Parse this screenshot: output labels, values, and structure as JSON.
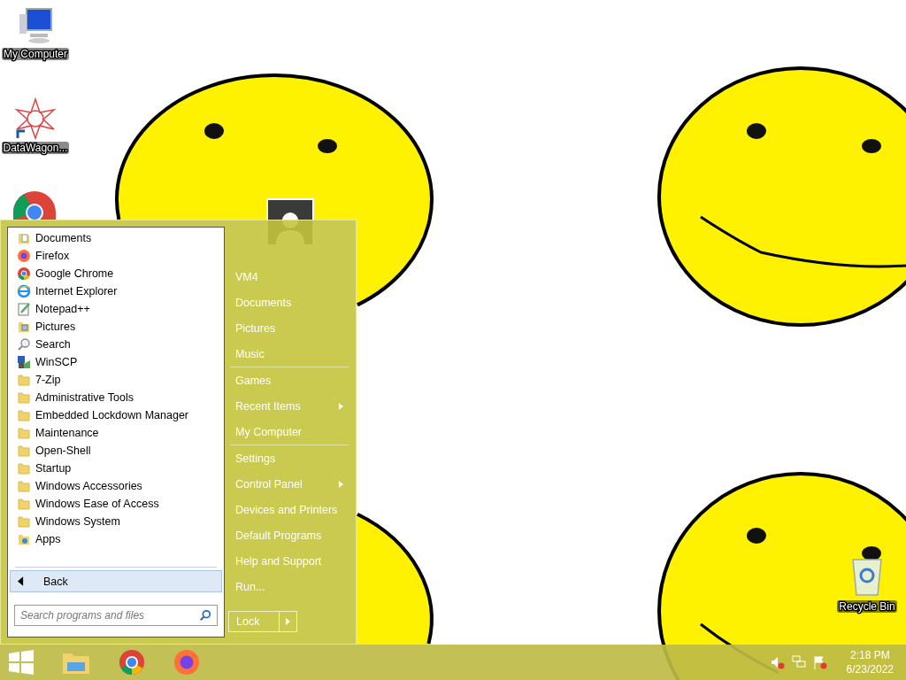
{
  "desktop_icons": [
    {
      "label": "My Computer",
      "kind": "computer"
    },
    {
      "label": "DataWagon...",
      "kind": "shortcut"
    },
    {
      "label": "Recycle Bin",
      "kind": "bin"
    }
  ],
  "start_menu": {
    "programs": [
      {
        "label": "Documents",
        "kind": "app"
      },
      {
        "label": "Firefox",
        "kind": "app"
      },
      {
        "label": "Google Chrome",
        "kind": "app"
      },
      {
        "label": "Internet Explorer",
        "kind": "app"
      },
      {
        "label": "Notepad++",
        "kind": "app"
      },
      {
        "label": "Pictures",
        "kind": "app"
      },
      {
        "label": "Search",
        "kind": "app"
      },
      {
        "label": "WinSCP",
        "kind": "app"
      },
      {
        "label": "7-Zip",
        "kind": "folder"
      },
      {
        "label": "Administrative Tools",
        "kind": "folder"
      },
      {
        "label": "Embedded Lockdown Manager",
        "kind": "folder"
      },
      {
        "label": "Maintenance",
        "kind": "folder"
      },
      {
        "label": "Open-Shell",
        "kind": "folder"
      },
      {
        "label": "Startup",
        "kind": "folder"
      },
      {
        "label": "Windows Accessories",
        "kind": "folder"
      },
      {
        "label": "Windows Ease of Access",
        "kind": "folder"
      },
      {
        "label": "Windows System",
        "kind": "folder"
      },
      {
        "label": "Apps",
        "kind": "app"
      }
    ],
    "back": {
      "label": "Back",
      "selected": true
    },
    "search": {
      "placeholder": "Search programs and files"
    },
    "places": [
      [
        {
          "label": "VM4",
          "submenu": false
        },
        {
          "label": "Documents",
          "submenu": false
        },
        {
          "label": "Pictures",
          "submenu": false
        },
        {
          "label": "Music",
          "submenu": false
        }
      ],
      [
        {
          "label": "Games",
          "submenu": false
        },
        {
          "label": "Recent Items",
          "submenu": true
        },
        {
          "label": "My Computer",
          "submenu": false
        }
      ],
      [
        {
          "label": "Settings",
          "submenu": false
        },
        {
          "label": "Control Panel",
          "submenu": true
        },
        {
          "label": "Devices and Printers",
          "submenu": false
        },
        {
          "label": "Default Programs",
          "submenu": false
        },
        {
          "label": "Help and Support",
          "submenu": false
        },
        {
          "label": "Run...",
          "submenu": false
        }
      ]
    ],
    "lock": {
      "label": "Lock"
    }
  },
  "taskbar": {
    "clock": {
      "time": "2:18 PM",
      "date": "6/23/2022"
    }
  }
}
